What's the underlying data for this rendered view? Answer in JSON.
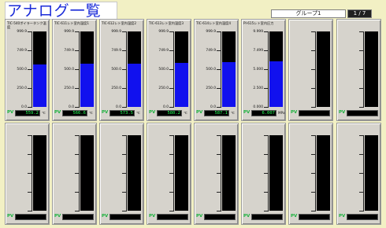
{
  "header": {
    "title": "アナログ一覧",
    "group_label": "グループ1",
    "page_indicator": "1 / 7"
  },
  "colors": {
    "background": "#f2f0c4",
    "title_text": "#1a2bd8",
    "bar_fill": "#1111ee",
    "bar_bg": "#000000",
    "pv_text": "#22ff55"
  },
  "pv_label": "PV",
  "panels": [
    {
      "title": "TIC-540ボイラータンク温度",
      "ticks": [
        "999.9",
        "749.9",
        "500.0",
        "250.0",
        "0.0"
      ],
      "value": "559.2",
      "unit": "℃",
      "level": 0.56
    },
    {
      "title": "TIC-611レト室内温度1",
      "ticks": [
        "999.9",
        "749.9",
        "500.0",
        "250.0",
        "0.0"
      ],
      "value": "566.6",
      "unit": "℃",
      "level": 0.57
    },
    {
      "title": "TIC-612レト室内温度2",
      "ticks": [
        "999.9",
        "749.9",
        "500.0",
        "250.0",
        "0.0"
      ],
      "value": "573.5",
      "unit": "℃",
      "level": 0.57
    },
    {
      "title": "TIC-613レト室内温度3",
      "ticks": [
        "999.9",
        "749.9",
        "500.0",
        "250.0",
        "0.0"
      ],
      "value": "580.2",
      "unit": "℃",
      "level": 0.58
    },
    {
      "title": "TIC-614レト室内温度4",
      "ticks": [
        "999.9",
        "749.9",
        "500.0",
        "250.0",
        "0.0"
      ],
      "value": "587.1",
      "unit": "℃",
      "level": 0.59
    },
    {
      "title": "PI-615レト室内圧力",
      "ticks": [
        "9.999",
        "7.499",
        "5.000",
        "2.500",
        "0.000"
      ],
      "value": "6.007",
      "unit": "MPa",
      "level": 0.6
    },
    {
      "title": "",
      "ticks": [],
      "value": "",
      "unit": "",
      "level": 0
    },
    {
      "title": "",
      "ticks": [],
      "value": "",
      "unit": "",
      "level": 0
    },
    {
      "title": "",
      "ticks": [],
      "value": "",
      "unit": "",
      "level": 0
    },
    {
      "title": "",
      "ticks": [],
      "value": "",
      "unit": "",
      "level": 0
    },
    {
      "title": "",
      "ticks": [],
      "value": "",
      "unit": "",
      "level": 0
    },
    {
      "title": "",
      "ticks": [],
      "value": "",
      "unit": "",
      "level": 0
    },
    {
      "title": "",
      "ticks": [],
      "value": "",
      "unit": "",
      "level": 0
    },
    {
      "title": "",
      "ticks": [],
      "value": "",
      "unit": "",
      "level": 0
    },
    {
      "title": "",
      "ticks": [],
      "value": "",
      "unit": "",
      "level": 0
    },
    {
      "title": "",
      "ticks": [],
      "value": "",
      "unit": "",
      "level": 0
    }
  ]
}
